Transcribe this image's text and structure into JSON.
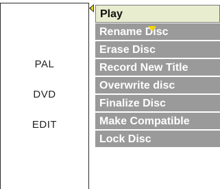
{
  "info_panel": {
    "lines": [
      "PAL",
      "DVD",
      "EDIT"
    ]
  },
  "menu": {
    "items": [
      {
        "label": "Play",
        "selected": true
      },
      {
        "label": "Rename Disc",
        "selected": false
      },
      {
        "label": "Erase Disc",
        "selected": false
      },
      {
        "label": "Record New Title",
        "selected": false
      },
      {
        "label": "Overwrite disc",
        "selected": false
      },
      {
        "label": "Finalize Disc",
        "selected": false
      },
      {
        "label": "Make Compatible",
        "selected": false
      },
      {
        "label": "Lock Disc",
        "selected": false
      }
    ]
  },
  "icons": {
    "pointer": "left-pointer-icon",
    "cursor": "down-cursor-icon"
  },
  "colors": {
    "selected_bg": "#e9edcf",
    "item_bg": "#9a9a9a",
    "item_text": "#ffffff",
    "accent": "#f2d400"
  }
}
